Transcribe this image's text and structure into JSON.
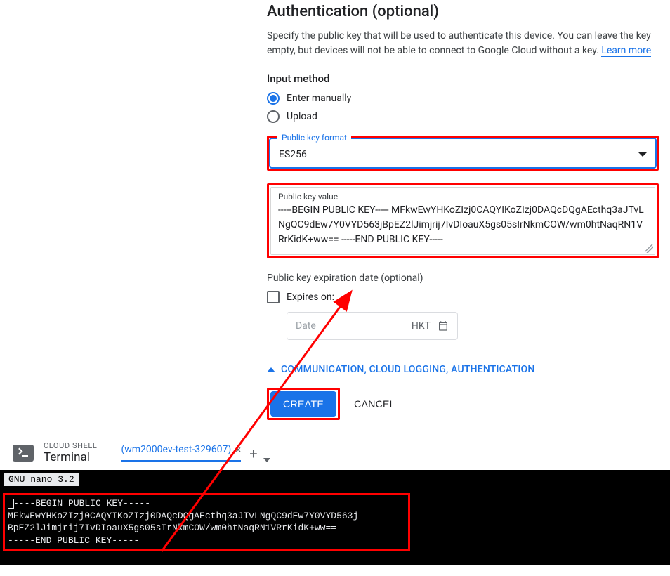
{
  "auth": {
    "heading": "Authentication (optional)",
    "desc_prefix": "Specify the public key that will be used to authenticate this device. You can leave the key empty, but devices will not be able to connect to Google Cloud without a key. ",
    "learn_more": "Learn more"
  },
  "input_method": {
    "heading": "Input method",
    "options": [
      "Enter manually",
      "Upload"
    ],
    "selected": 0
  },
  "key_format": {
    "label": "Public key format",
    "value": "ES256"
  },
  "key_value": {
    "label": "Public key value",
    "text": "-----BEGIN PUBLIC KEY-----\nMFkwEwYHKoZIzj0CAQYIKoZIzj0DAQcDQgAEcthq3aJTvLNgQC9dEw7Y0VYD563jBpEZ2lJimjrij7IvDIoauX5gs05sIrNkmCOW/wm0htNaqRN1VRrKidK+ww==\n-----END PUBLIC KEY-----"
  },
  "expiration": {
    "label": "Public key expiration date (optional)",
    "checkbox_label": "Expires on:",
    "date_placeholder": "Date",
    "tz": "HKT"
  },
  "expander_label": "COMMUNICATION, CLOUD LOGGING, AUTHENTICATION",
  "buttons": {
    "create": "CREATE",
    "cancel": "CANCEL"
  },
  "shell": {
    "small": "CLOUD SHELL",
    "title": "Terminal",
    "tab_label": "(wm2000ev-test-329607)",
    "nano_title": "  GNU nano 3.2",
    "key_text": "----BEGIN PUBLIC KEY-----\nMFkwEwYHKoZIzj0CAQYIKoZIzj0DAQcDQgAEcthq3aJTvLNgQC9dEw7Y0VYD563j\nBpEZ2lJimjrij7IvDIoauX5gs05sIrNkmCOW/wm0htNaqRN1VRrKidK+ww==\n-----END PUBLIC KEY-----"
  }
}
